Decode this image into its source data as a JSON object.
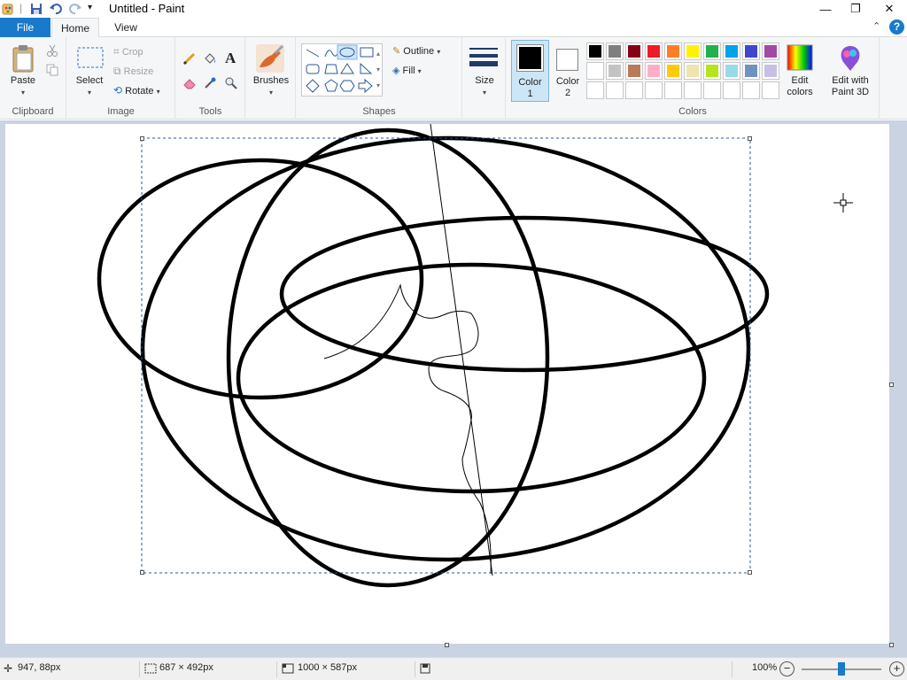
{
  "window": {
    "title": "Untitled - Paint",
    "minimize": "—",
    "restore": "❐",
    "close": "✕"
  },
  "tabs": {
    "file": "File",
    "home": "Home",
    "view": "View",
    "help": "?"
  },
  "ribbon": {
    "clipboard": {
      "group": "Clipboard",
      "paste": "Paste"
    },
    "image": {
      "group": "Image",
      "select": "Select",
      "crop": "Crop",
      "resize": "Resize",
      "rotate": "Rotate"
    },
    "tools": {
      "group": "Tools"
    },
    "brushes": {
      "label": "Brushes"
    },
    "shapes": {
      "group": "Shapes",
      "outline": "Outline",
      "fill": "Fill"
    },
    "size": {
      "label": "Size"
    },
    "color1": {
      "label": "Color",
      "num": "1",
      "color": "#000000"
    },
    "color2": {
      "label": "Color",
      "num": "2",
      "color": "#ffffff"
    },
    "colors": {
      "group": "Colors",
      "row1": [
        "#000000",
        "#7f7f7f",
        "#880015",
        "#ed1c24",
        "#ff7f27",
        "#fff200",
        "#22b14c",
        "#00a2e8",
        "#3f48cc",
        "#a349a4"
      ],
      "row2": [
        "#ffffff",
        "#c3c3c3",
        "#b97a57",
        "#ffaec9",
        "#ffc90e",
        "#efe4b0",
        "#b5e61d",
        "#99d9ea",
        "#7092be",
        "#c8bfe7"
      ]
    },
    "edit_colors": {
      "line1": "Edit",
      "line2": "colors"
    },
    "paint3d": {
      "line1": "Edit with",
      "line2": "Paint 3D"
    }
  },
  "status": {
    "cursor_pos": "947, 88px",
    "selection_size": "687 × 492px",
    "canvas_size": "1000 × 587px",
    "zoom": "100%",
    "zoom_fraction": 0.5
  }
}
